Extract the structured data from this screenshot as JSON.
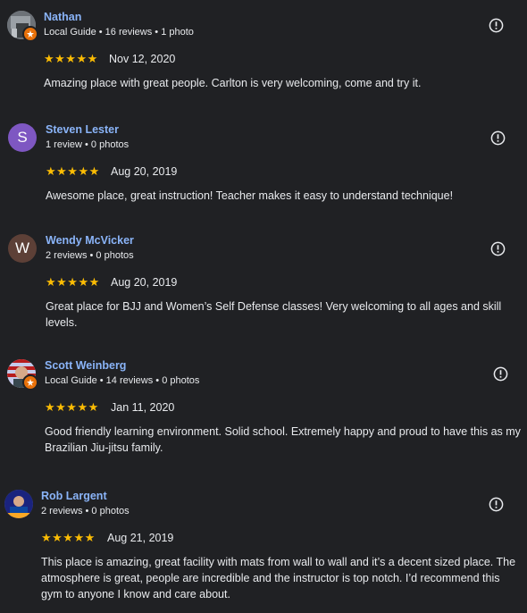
{
  "colors": {
    "background": "#202124",
    "name_link": "#8ab4f8",
    "star": "#fbbc04",
    "local_guide_badge": "#e8710a",
    "avatar_s": "#7e57c2",
    "avatar_w": "#5d4037"
  },
  "reviews": [
    {
      "name": "Nathan",
      "meta": "Local Guide • 16 reviews • 1 photo",
      "rating": 5,
      "stars": "★★★★★",
      "date": "Nov 12, 2020",
      "text": "Amazing place with great people. Carlton is very welcoming, come and try it.",
      "avatar_type": "photo",
      "local_guide": true,
      "flag_icon": "flag-icon"
    },
    {
      "name": "Steven Lester",
      "meta": "1 review • 0 photos",
      "rating": 5,
      "stars": "★★★★★",
      "date": "Aug 20, 2019",
      "text": "Awesome place, great instruction! Teacher makes it easy to understand technique!",
      "avatar_type": "letter",
      "avatar_letter": "S",
      "local_guide": false,
      "flag_icon": "flag-icon"
    },
    {
      "name": "Wendy McVicker",
      "meta": "2 reviews • 0 photos",
      "rating": 5,
      "stars": "★★★★★",
      "date": "Aug 20, 2019",
      "text": "Great place for BJJ and Women’s Self Defense classes! Very welcoming to all ages and skill levels.",
      "avatar_type": "letter",
      "avatar_letter": "W",
      "local_guide": false,
      "flag_icon": "flag-icon"
    },
    {
      "name": "Scott Weinberg",
      "meta": "Local Guide • 14 reviews • 0 photos",
      "rating": 5,
      "stars": "★★★★★",
      "date": "Jan 11, 2020",
      "text": "Good friendly learning environment. Solid school. Extremely happy and proud to have this as my Brazilian Jiu-jitsu family.",
      "avatar_type": "photo",
      "local_guide": true,
      "flag_icon": "flag-icon"
    },
    {
      "name": "Rob Largent",
      "meta": "2 reviews • 0 photos",
      "rating": 5,
      "stars": "★★★★★",
      "date": "Aug 21, 2019",
      "text": "This place is amazing, great facility with mats from wall to wall and it’s a decent sized place. The atmosphere is great, people are incredible and the instructor is top notch. I’d recommend this gym to anyone I know and care about.",
      "avatar_type": "photo",
      "local_guide": false,
      "flag_icon": "flag-icon"
    }
  ]
}
